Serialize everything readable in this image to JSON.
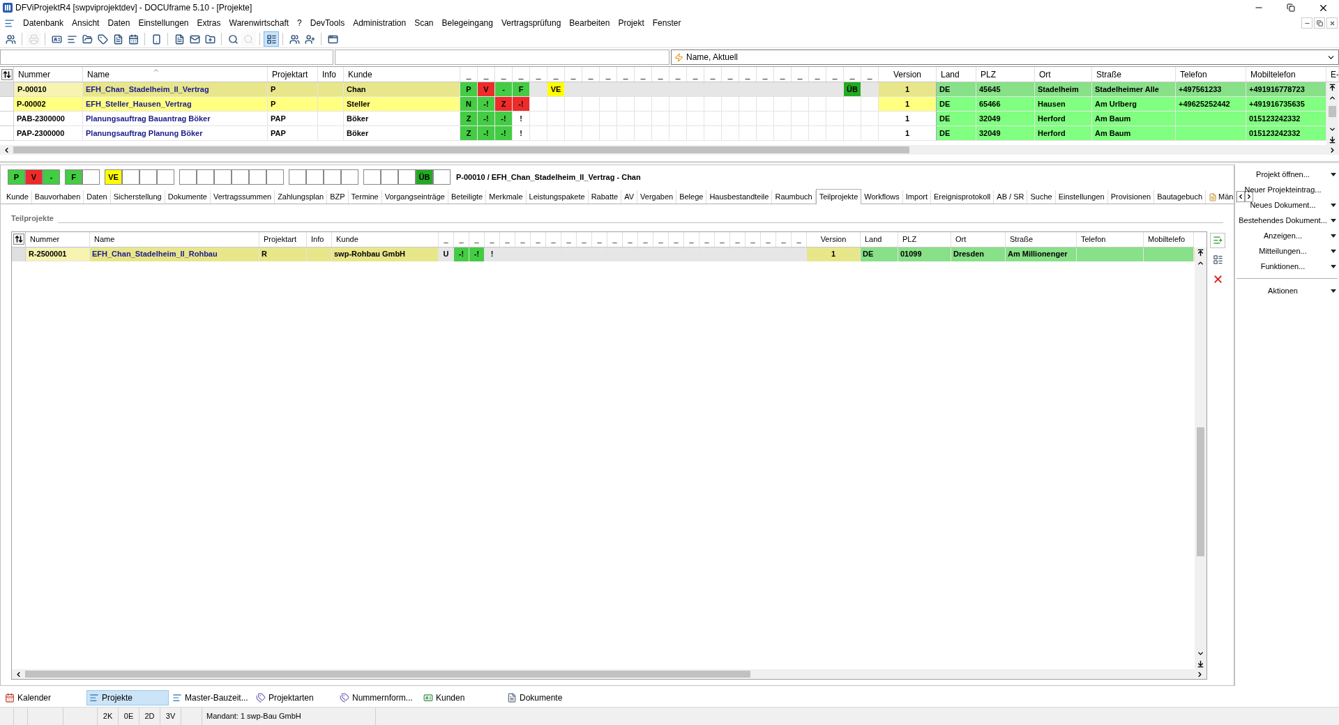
{
  "window": {
    "title": "DFViProjektR4 [swpviprojektdev] - DOCUframe 5.10 - [Projekte]"
  },
  "menu": [
    "Datenbank",
    "Ansicht",
    "Daten",
    "Einstellungen",
    "Extras",
    "Warenwirtschaft",
    "?",
    "DevTools",
    "Administration",
    "Scan",
    "Belegeingang",
    "Vertragsprüfung",
    "Bearbeiten",
    "Projekt",
    "Fenster"
  ],
  "toolbar": [
    {
      "disabled": false,
      "pressed": false
    },
    {
      "disabled": true,
      "pressed": false
    },
    {
      "disabled": false,
      "pressed": false
    },
    {
      "disabled": false,
      "pressed": false
    },
    {
      "disabled": false,
      "pressed": false
    },
    {
      "disabled": false,
      "pressed": false
    },
    {
      "disabled": false,
      "pressed": false
    },
    {
      "disabled": false,
      "pressed": false
    },
    {
      "disabled": false,
      "pressed": false
    },
    {
      "disabled": false,
      "pressed": false
    },
    {
      "disabled": false,
      "pressed": false
    },
    {
      "disabled": false,
      "pressed": false
    },
    {
      "disabled": false,
      "pressed": false
    },
    {
      "disabled": true,
      "pressed": false
    },
    {
      "disabled": false,
      "pressed": true
    },
    {
      "disabled": false,
      "pressed": false
    },
    {
      "disabled": false,
      "pressed": false
    },
    {
      "disabled": false,
      "pressed": false
    }
  ],
  "filter": {
    "sort": "Name, Aktuell"
  },
  "grid": {
    "columns_left": [
      "Nummer",
      "Name",
      "Projektart",
      "Info",
      "Kunde"
    ],
    "flag_columns": [
      "_",
      "_",
      "_",
      "_",
      "_",
      "_",
      "_",
      "_",
      "_",
      "_",
      "_",
      "_",
      "_",
      "_",
      "_",
      "_",
      "_",
      "_",
      "_",
      "_",
      "_",
      "_",
      "_",
      "_"
    ],
    "columns_right": [
      "Version",
      "Land",
      "PLZ",
      "Ort",
      "Straße",
      "Telefon",
      "Mobiltelefon",
      "E-"
    ],
    "rows": [
      {
        "selected": true,
        "marked": false,
        "nummer": "P-00010",
        "name": "EFH_Chan_Stadelheim_II_Vertrag",
        "projektart": "P",
        "kunde": "Chan",
        "flags": [
          {
            "kind": "flag",
            "text": "P",
            "color": "#44cc44"
          },
          {
            "kind": "flag",
            "text": "V",
            "color": "#ee2b2b"
          },
          {
            "kind": "flag",
            "text": "-",
            "color": "#44cc44"
          },
          {
            "kind": "flag",
            "text": "F",
            "color": "#44cc44"
          },
          {
            "kind": "blank"
          },
          {
            "kind": "flag",
            "text": "VE",
            "color": "#ffff00"
          },
          {
            "kind": "blank"
          },
          {
            "kind": "blank"
          },
          {
            "kind": "blank"
          },
          {
            "kind": "blank"
          },
          {
            "kind": "blank"
          },
          {
            "kind": "blank"
          },
          {
            "kind": "blank"
          },
          {
            "kind": "blank"
          },
          {
            "kind": "blank"
          },
          {
            "kind": "blank"
          },
          {
            "kind": "blank"
          },
          {
            "kind": "blank"
          },
          {
            "kind": "blank"
          },
          {
            "kind": "blank"
          },
          {
            "kind": "blank"
          },
          {
            "kind": "blank"
          },
          {
            "kind": "flag",
            "text": "ÜB",
            "color": "#22aa22"
          },
          {
            "kind": "blank"
          }
        ],
        "version": "1",
        "land": "DE",
        "plz": "45645",
        "ort": "Stadelheim",
        "strasse": "Stadelheimer Alle",
        "telefon": "+497561233",
        "mobiltelefon": "+491916778723"
      },
      {
        "selected": false,
        "marked": true,
        "nummer": "P-00002",
        "name": "EFH_Steller_Hausen_Vertrag",
        "projektart": "P",
        "kunde": "Steller",
        "flags": [
          {
            "kind": "flag",
            "text": "N",
            "color": "#44cc44"
          },
          {
            "kind": "flag",
            "text": "-!",
            "color": "#44cc44"
          },
          {
            "kind": "flag",
            "text": "Z",
            "color": "#ee2b2b"
          },
          {
            "kind": "flag",
            "text": "-!",
            "color": "#ee2b2b"
          },
          {
            "kind": "blank"
          },
          {
            "kind": "blank"
          },
          {
            "kind": "blank"
          },
          {
            "kind": "blank"
          },
          {
            "kind": "blank"
          },
          {
            "kind": "blank"
          },
          {
            "kind": "blank"
          },
          {
            "kind": "blank"
          },
          {
            "kind": "blank"
          },
          {
            "kind": "blank"
          },
          {
            "kind": "blank"
          },
          {
            "kind": "blank"
          },
          {
            "kind": "blank"
          },
          {
            "kind": "blank"
          },
          {
            "kind": "blank"
          },
          {
            "kind": "blank"
          },
          {
            "kind": "blank"
          },
          {
            "kind": "blank"
          },
          {
            "kind": "blank"
          },
          {
            "kind": "blank"
          }
        ],
        "version": "1",
        "land": "DE",
        "plz": "65466",
        "ort": "Hausen",
        "strasse": "Am Urlberg",
        "telefon": "+49625252442",
        "mobiltelefon": "+491916735635"
      },
      {
        "selected": false,
        "marked": false,
        "nummer": "PAB-2300000",
        "name": "Planungsauftrag Bauantrag Böker",
        "projektart": "PAP",
        "kunde": "Böker",
        "flags": [
          {
            "kind": "flag",
            "text": "Z",
            "color": "#44cc44"
          },
          {
            "kind": "flag",
            "text": "-!",
            "color": "#44cc44"
          },
          {
            "kind": "flag",
            "text": "-!",
            "color": "#44cc44"
          },
          {
            "kind": "flag",
            "text": "!"
          },
          {
            "kind": "blank"
          },
          {
            "kind": "blank"
          },
          {
            "kind": "blank"
          },
          {
            "kind": "blank"
          },
          {
            "kind": "blank"
          },
          {
            "kind": "blank"
          },
          {
            "kind": "blank"
          },
          {
            "kind": "blank"
          },
          {
            "kind": "blank"
          },
          {
            "kind": "blank"
          },
          {
            "kind": "blank"
          },
          {
            "kind": "blank"
          },
          {
            "kind": "blank"
          },
          {
            "kind": "blank"
          },
          {
            "kind": "blank"
          },
          {
            "kind": "blank"
          },
          {
            "kind": "blank"
          },
          {
            "kind": "blank"
          },
          {
            "kind": "blank"
          },
          {
            "kind": "blank"
          }
        ],
        "version": "1",
        "land": "DE",
        "plz": "32049",
        "ort": "Herford",
        "strasse": "Am Baum",
        "mobiltelefon": "015123242332"
      },
      {
        "selected": false,
        "marked": false,
        "nummer": "PAP-2300000",
        "name": "Planungsauftrag Planung Böker",
        "projektart": "PAP",
        "kunde": "Böker",
        "flags": [
          {
            "kind": "flag",
            "text": "Z",
            "color": "#44cc44"
          },
          {
            "kind": "flag",
            "text": "-!",
            "color": "#44cc44"
          },
          {
            "kind": "flag",
            "text": "-!",
            "color": "#44cc44"
          },
          {
            "kind": "flag",
            "text": "!"
          },
          {
            "kind": "blank"
          },
          {
            "kind": "blank"
          },
          {
            "kind": "blank"
          },
          {
            "kind": "blank"
          },
          {
            "kind": "blank"
          },
          {
            "kind": "blank"
          },
          {
            "kind": "blank"
          },
          {
            "kind": "blank"
          },
          {
            "kind": "blank"
          },
          {
            "kind": "blank"
          },
          {
            "kind": "blank"
          },
          {
            "kind": "blank"
          },
          {
            "kind": "blank"
          },
          {
            "kind": "blank"
          },
          {
            "kind": "blank"
          },
          {
            "kind": "blank"
          },
          {
            "kind": "blank"
          },
          {
            "kind": "blank"
          },
          {
            "kind": "blank"
          },
          {
            "kind": "blank"
          }
        ],
        "version": "1",
        "land": "DE",
        "plz": "32049",
        "ort": "Herford",
        "strasse": "Am Baum",
        "mobiltelefon": "015123242332"
      }
    ]
  },
  "detail": {
    "status_flags": [
      {
        "kind": "flag",
        "text": "P",
        "color": "#44cc44"
      },
      {
        "kind": "flag",
        "text": "V",
        "color": "#ee2b2b"
      },
      {
        "kind": "flag",
        "text": "-",
        "color": "#44cc44"
      },
      {
        "kind": "flag",
        "text": "F",
        "color": "#44cc44"
      },
      {
        "kind": "blank"
      },
      {
        "kind": "flag",
        "text": "VE",
        "color": "#ffff00"
      },
      {
        "kind": "blank"
      },
      {
        "kind": "blank"
      },
      {
        "kind": "blank"
      },
      {
        "kind": "blank"
      },
      {
        "kind": "blank"
      },
      {
        "kind": "blank"
      },
      {
        "kind": "blank"
      },
      {
        "kind": "blank"
      },
      {
        "kind": "blank"
      },
      {
        "kind": "blank"
      },
      {
        "kind": "blank"
      },
      {
        "kind": "blank"
      },
      {
        "kind": "blank"
      },
      {
        "kind": "blank"
      },
      {
        "kind": "blank"
      },
      {
        "kind": "blank"
      },
      {
        "kind": "flag",
        "text": "ÜB",
        "color": "#22aa22"
      },
      {
        "kind": "blank"
      }
    ],
    "caption": "P-00010 / EFH_Chan_Stadelheim_II_Vertrag - Chan",
    "tabs": [
      {
        "label": "Kunde",
        "selected": false
      },
      {
        "label": "Bauvorhaben",
        "selected": false
      },
      {
        "label": "Daten",
        "selected": false
      },
      {
        "label": "Sicherstellung",
        "selected": false
      },
      {
        "label": "Dokumente",
        "selected": false
      },
      {
        "label": "Vertragssummen",
        "selected": false
      },
      {
        "label": "Zahlungsplan",
        "selected": false
      },
      {
        "label": "BZP",
        "selected": false
      },
      {
        "label": "Termine",
        "selected": false
      },
      {
        "label": "Vorgangseinträge",
        "selected": false
      },
      {
        "label": "Beteiligte",
        "selected": false
      },
      {
        "label": "Merkmale",
        "selected": false
      },
      {
        "label": "Leistungspakete",
        "selected": false
      },
      {
        "label": "Rabatte",
        "selected": false
      },
      {
        "label": "AV",
        "selected": false
      },
      {
        "label": "Vergaben",
        "selected": false
      },
      {
        "label": "Belege",
        "selected": false
      },
      {
        "label": "Hausbestandteile",
        "selected": false
      },
      {
        "label": "Raumbuch",
        "selected": false
      },
      {
        "label": "Teilprojekte",
        "selected": true
      },
      {
        "label": "Workflows",
        "selected": false
      },
      {
        "label": "Import",
        "selected": false
      },
      {
        "label": "Ereignisprotokoll",
        "selected": false
      },
      {
        "label": "AB / SR",
        "selected": false
      },
      {
        "label": "Suche",
        "selected": false
      },
      {
        "label": "Einstellungen",
        "selected": false
      },
      {
        "label": "Provisionen",
        "selected": false
      },
      {
        "label": "Bautagebuch",
        "selected": false
      },
      {
        "label": "Män",
        "selected": false
      }
    ],
    "group_title": "Teilprojekte",
    "subgrid": {
      "columns_left": [
        "Nummer",
        "Name",
        "Projektart",
        "Info",
        "Kunde"
      ],
      "flag_columns": [
        "_",
        "_",
        "_",
        "_",
        "_",
        "_",
        "_",
        "_",
        "_",
        "_",
        "_",
        "_",
        "_",
        "_",
        "_",
        "_",
        "_",
        "_",
        "_",
        "_",
        "_",
        "_",
        "_",
        "_"
      ],
      "columns_right": [
        "Version",
        "Land",
        "PLZ",
        "Ort",
        "Straße",
        "Telefon",
        "Mobiltelefo"
      ],
      "rows": [
        {
          "selected": true,
          "nummer": "R-2500001",
          "name": "EFH_Chan_Stadelheim_II_Rohbau",
          "projektart": "R",
          "kunde": "swp-Rohbau GmbH",
          "flags": [
            {
              "kind": "flag",
              "text": "U"
            },
            {
              "kind": "flag",
              "text": "-!",
              "color": "#44cc44"
            },
            {
              "kind": "flag",
              "text": "-!",
              "color": "#44cc44"
            },
            {
              "kind": "flag",
              "text": "!"
            },
            {
              "kind": "blank"
            },
            {
              "kind": "blank"
            },
            {
              "kind": "blank"
            },
            {
              "kind": "blank"
            },
            {
              "kind": "blank"
            },
            {
              "kind": "blank"
            },
            {
              "kind": "blank"
            },
            {
              "kind": "blank"
            },
            {
              "kind": "blank"
            },
            {
              "kind": "blank"
            },
            {
              "kind": "blank"
            },
            {
              "kind": "blank"
            },
            {
              "kind": "blank"
            },
            {
              "kind": "blank"
            },
            {
              "kind": "blank"
            },
            {
              "kind": "blank"
            },
            {
              "kind": "blank"
            },
            {
              "kind": "blank"
            },
            {
              "kind": "blank"
            },
            {
              "kind": "blank"
            }
          ],
          "version": "1",
          "land": "DE",
          "plz": "01099",
          "ort": "Dresden",
          "strasse": "Am Millionenger"
        }
      ]
    }
  },
  "actions": [
    {
      "label": "Projekt öffnen...",
      "menu": true
    },
    {
      "label": "Neuer Projekteintrag...",
      "menu": false
    },
    {
      "label": "Neues Dokument...",
      "menu": true
    },
    {
      "label": "Bestehendes Dokument...",
      "menu": true
    },
    {
      "label": "Anzeigen...",
      "menu": true
    },
    {
      "label": "Mitteilungen...",
      "menu": true
    },
    {
      "label": "Funktionen...",
      "menu": true
    }
  ],
  "actions_footer": {
    "label": "Aktionen",
    "menu": true
  },
  "navigation": [
    {
      "label": "Kalender",
      "selected": false
    },
    {
      "label": "Projekte",
      "selected": true
    },
    {
      "label": "Master-Bauzeit...",
      "selected": false
    },
    {
      "label": "Projektarten",
      "selected": false
    },
    {
      "label": "Nummernform...",
      "selected": false
    },
    {
      "label": "Kunden",
      "selected": false
    },
    {
      "label": "Dokumente",
      "selected": false
    }
  ],
  "status_bar": {
    "counters": [
      "2K",
      "0E",
      "2D",
      "3V"
    ],
    "mandant": "Mandant: 1 swp-Bau GmbH"
  }
}
